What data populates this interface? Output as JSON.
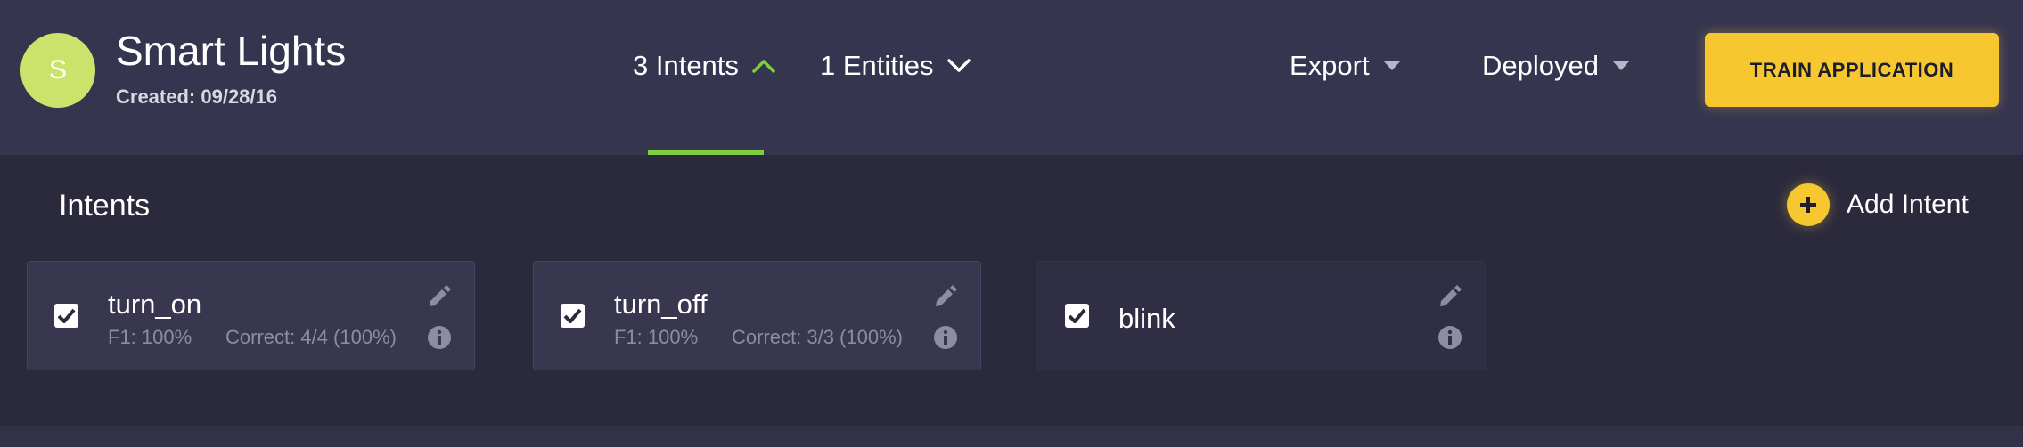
{
  "header": {
    "avatar_letter": "S",
    "app_title": "Smart Lights",
    "created": "Created: 09/28/16",
    "tabs": [
      {
        "label": "3 Intents",
        "icon": "chevron-up-icon",
        "active": true
      },
      {
        "label": "1 Entities",
        "icon": "chevron-down-icon",
        "active": false
      }
    ],
    "export_label": "Export",
    "deployed_label": "Deployed",
    "train_label": "TRAIN APPLICATION"
  },
  "main": {
    "section_title": "Intents",
    "add_label": "Add Intent",
    "cards": [
      {
        "name": "turn_on",
        "f1": "F1: 100%",
        "correct": "Correct: 4/4 (100%)",
        "checked": true
      },
      {
        "name": "turn_off",
        "f1": "F1: 100%",
        "correct": "Correct: 3/3 (100%)",
        "checked": true
      },
      {
        "name": "blink",
        "f1": "",
        "correct": "",
        "checked": true
      }
    ]
  },
  "colors": {
    "background": "#2b2a3d",
    "header": "#363550",
    "accent_yellow": "#f7c730",
    "accent_green": "#7dcf3d",
    "avatar": "#cbe36a"
  }
}
